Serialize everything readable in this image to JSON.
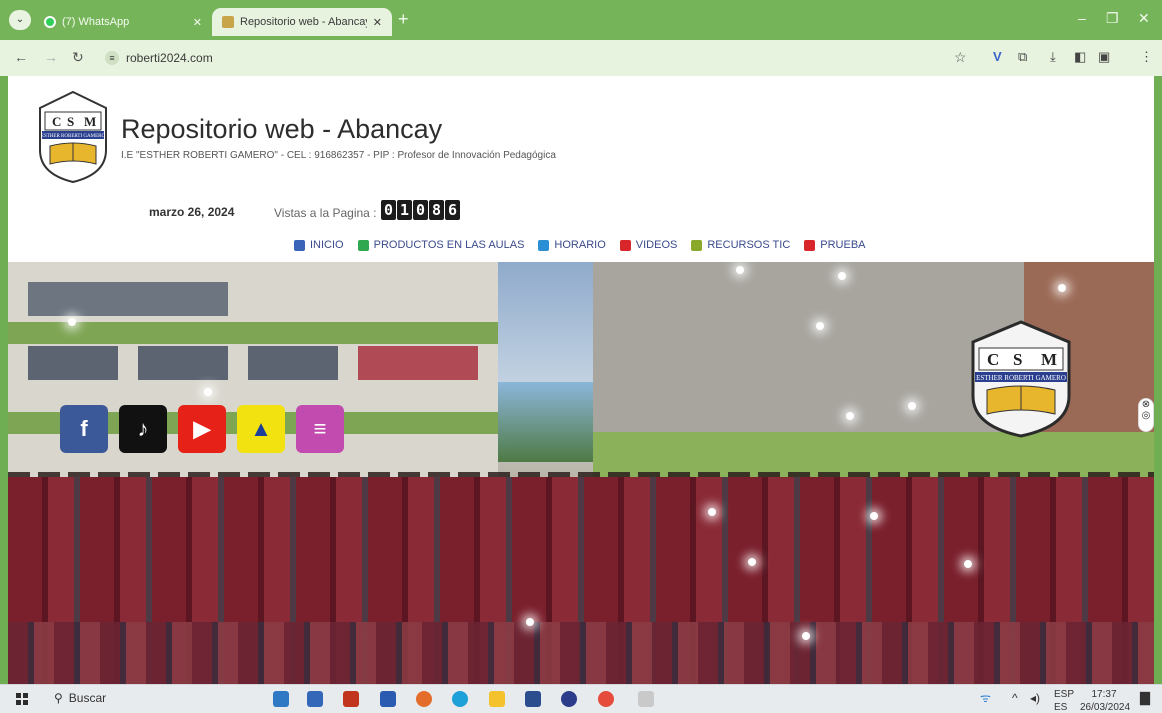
{
  "browser": {
    "tabs": [
      {
        "title": "(7) WhatsApp",
        "active": false
      },
      {
        "title": "Repositorio web - Abancay - I",
        "active": true
      }
    ],
    "url": "roberti2024.com"
  },
  "site": {
    "title": "Repositorio web - Abancay",
    "subtitle": "I.E \"ESTHER ROBERTI GAMERO\" - CEL : 916862357 - PIP : Profesor de Innovación Pedagógica",
    "date": "marzo 26, 2024",
    "views_label": "Vistas a la Pagina :",
    "views_digits": [
      "0",
      "1",
      "0",
      "8",
      "6"
    ],
    "logo_letters": [
      "C",
      "S",
      "M"
    ],
    "logo_band": "ESTHER ROBERTI GAMERO"
  },
  "menu": [
    {
      "label": "INICIO",
      "icon": "home-icon",
      "color": "#3a64b7"
    },
    {
      "label": "PRODUCTOS EN LAS AULAS",
      "icon": "products-icon",
      "color": "#2fa84f"
    },
    {
      "label": "HORARIO",
      "icon": "person-icon",
      "color": "#2b8fd6"
    },
    {
      "label": "VIDEOS",
      "icon": "video-icon",
      "color": "#d8262b"
    },
    {
      "label": "RECURSOS TIC",
      "icon": "resources-icon",
      "color": "#8aa82a"
    },
    {
      "label": "PRUEBA",
      "icon": "gift-icon",
      "color": "#d8262b"
    }
  ],
  "social": [
    {
      "name": "facebook-icon",
      "glyph": "f",
      "color": "#3b5998"
    },
    {
      "name": "tiktok-icon",
      "glyph": "♪",
      "color": "#111111"
    },
    {
      "name": "youtube-icon",
      "glyph": "▶",
      "color": "#e62117"
    },
    {
      "name": "drive-icon",
      "glyph": "▲",
      "color": "#f2e20f"
    },
    {
      "name": "book-icon",
      "glyph": "≡",
      "color": "#c24bb0"
    }
  ],
  "taskbar": {
    "search_label": "Buscar",
    "lang_top": "ESP",
    "lang_bottom": "ES",
    "time": "17:37",
    "date": "26/03/2024"
  }
}
